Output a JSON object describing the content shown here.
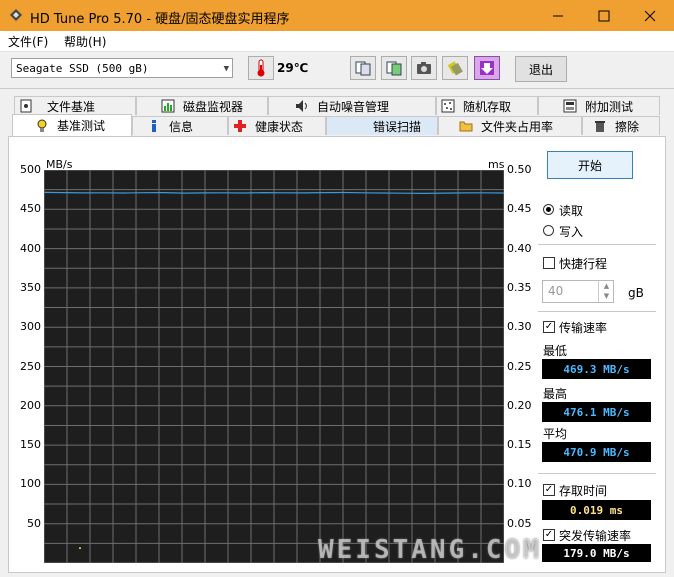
{
  "window": {
    "title": "HD Tune Pro 5.70 - 硬盘/固态硬盘实用程序"
  },
  "menu": [
    "文件(F)",
    "帮助(H)"
  ],
  "toolbar": {
    "drive": "Seagate SSD (500 gB)",
    "temperature": "29℃",
    "exit_label": "退出"
  },
  "tabs_top": [
    "文件基准",
    "磁盘监视器",
    "自动噪音管理",
    "随机存取",
    "附加测试"
  ],
  "tabs_bottom": [
    "基准测试",
    "信息",
    "健康状态",
    "错误扫描",
    "文件夹占用率",
    "擦除"
  ],
  "chart": {
    "left_unit": "MB/s",
    "right_unit": "ms",
    "left_ticks": [
      "500",
      "450",
      "400",
      "350",
      "300",
      "250",
      "200",
      "150",
      "100",
      "50"
    ],
    "right_ticks": [
      "0.50",
      "0.45",
      "0.40",
      "0.35",
      "0.30",
      "0.25",
      "0.20",
      "0.15",
      "0.10",
      "0.05"
    ]
  },
  "chart_data": {
    "type": "line",
    "title": "",
    "xlabel": "",
    "ylabel": "MB/s",
    "ylabel_right": "ms",
    "ylim": [
      0,
      500
    ],
    "ylim_right": [
      0,
      0.5
    ],
    "grid": true,
    "series": [
      {
        "values": [
          471.5,
          471.3,
          470.9,
          471.0,
          470.8,
          471.1,
          471.2,
          470.6,
          470.9,
          471.0,
          470.7,
          471.3,
          471.0,
          470.9,
          471.2,
          471.4,
          471.0,
          470.8,
          470.5,
          470.2,
          470.6,
          470.9,
          471.0,
          470.8
        ]
      }
    ]
  },
  "controls": {
    "start_label": "开始",
    "read_label": "读取",
    "write_label": "写入",
    "mode": "read",
    "short_stroke_label": "快捷行程",
    "short_stroke_checked": false,
    "short_stroke_value": "40",
    "short_stroke_unit": "gB",
    "transfer_rate_label": "传输速率",
    "transfer_rate_checked": true,
    "min_label": "最低",
    "min_value": "469.3 MB/s",
    "max_label": "最高",
    "max_value": "476.1 MB/s",
    "avg_label": "平均",
    "avg_value": "470.9 MB/s",
    "access_time_label": "存取时间",
    "access_time_checked": true,
    "access_time_value": "0.019 ms",
    "burst_rate_label": "突发传输速率",
    "burst_rate_checked": true,
    "burst_rate_value": "179.0 MB/s"
  },
  "watermark": "WEISTANG.COM",
  "colors": {
    "titlebar": "#f0a030",
    "chart_bg": "#1e1e1e",
    "grid": "#6e6e6e",
    "line": "#3a9ad9",
    "lcd_text": "#4db8ff"
  }
}
